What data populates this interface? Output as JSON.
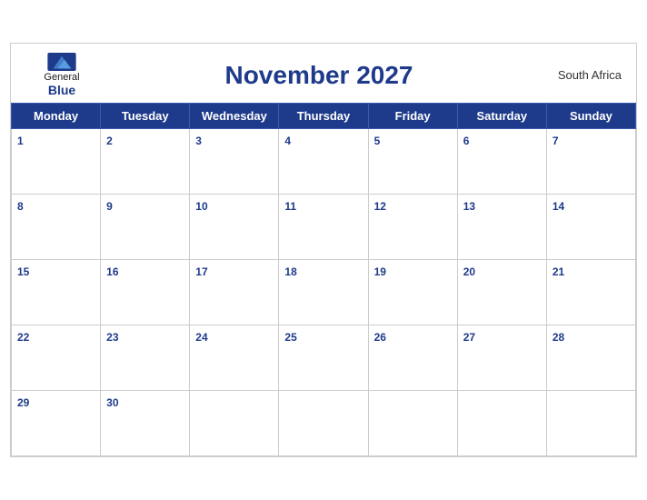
{
  "calendar": {
    "title": "November 2027",
    "country": "South Africa",
    "month": "November",
    "year": "2027",
    "days_of_week": [
      "Monday",
      "Tuesday",
      "Wednesday",
      "Thursday",
      "Friday",
      "Saturday",
      "Sunday"
    ],
    "weeks": [
      [
        1,
        2,
        3,
        4,
        5,
        6,
        7
      ],
      [
        8,
        9,
        10,
        11,
        12,
        13,
        14
      ],
      [
        15,
        16,
        17,
        18,
        19,
        20,
        21
      ],
      [
        22,
        23,
        24,
        25,
        26,
        27,
        28
      ],
      [
        29,
        30,
        null,
        null,
        null,
        null,
        null
      ]
    ],
    "logo": {
      "general": "General",
      "blue": "Blue"
    }
  }
}
